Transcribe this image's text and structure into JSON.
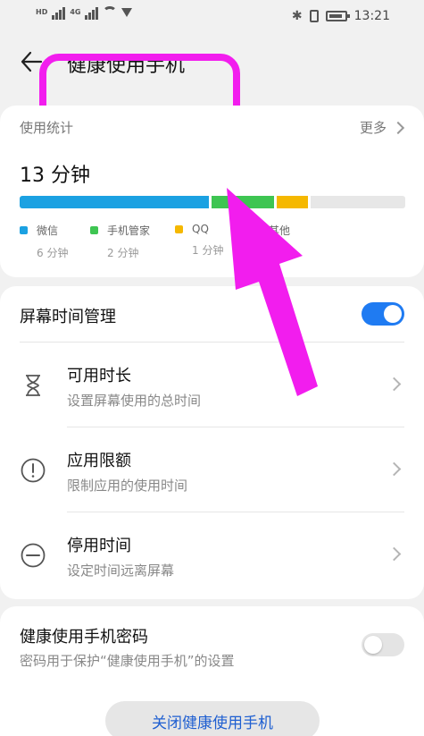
{
  "status_bar": {
    "left_badges": [
      "HD",
      "4G",
      "HD",
      "4G"
    ],
    "time": "13:21"
  },
  "header": {
    "title": "健康使用手机"
  },
  "usage": {
    "section_label": "使用统计",
    "more_label": "更多",
    "total": "13 分钟",
    "apps": [
      {
        "name": "微信",
        "duration": "6 分钟",
        "minutes": 6,
        "color": "#1ba1e2"
      },
      {
        "name": "手机管家",
        "duration": "2 分钟",
        "minutes": 2,
        "color": "#3ec552"
      },
      {
        "name": "QQ",
        "duration": "1 分钟",
        "minutes": 1,
        "color": "#f5b800"
      },
      {
        "name": "其他",
        "duration": "",
        "minutes": 3,
        "color": "#e7e7e7"
      }
    ]
  },
  "screen_time": {
    "label": "屏幕时间管理",
    "enabled": true,
    "items": [
      {
        "icon": "hourglass-icon",
        "title": "可用时长",
        "subtitle": "设置屏幕使用的总时间"
      },
      {
        "icon": "exclamation-circle-icon",
        "title": "应用限额",
        "subtitle": "限制应用的使用时间"
      },
      {
        "icon": "minus-circle-icon",
        "title": "停用时间",
        "subtitle": "设定时间远离屏幕"
      }
    ]
  },
  "password": {
    "title": "健康使用手机密码",
    "subtitle": "密码用于保护“健康使用手机”的设置",
    "enabled": false
  },
  "footer": {
    "close_button": "关闭健康使用手机"
  },
  "colors": {
    "accent": "#1f7bf2",
    "highlight": "#f21dee"
  }
}
